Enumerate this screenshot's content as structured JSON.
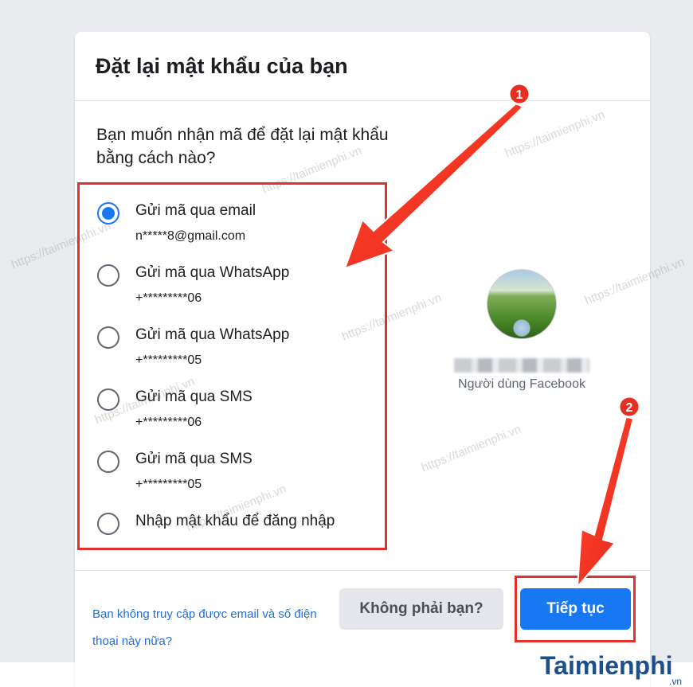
{
  "dialog": {
    "title": "Đặt lại mật khẩu của bạn",
    "question": "Bạn muốn nhận mã để đặt lại mật khẩu bằng cách nào?"
  },
  "options": [
    {
      "label": "Gửi mã qua email",
      "detail": "n*****8@gmail.com",
      "checked": true
    },
    {
      "label": "Gửi mã qua WhatsApp",
      "detail": "+*********06",
      "checked": false
    },
    {
      "label": "Gửi mã qua WhatsApp",
      "detail": "+*********05",
      "checked": false
    },
    {
      "label": "Gửi mã qua SMS",
      "detail": "+*********06",
      "checked": false
    },
    {
      "label": "Gửi mã qua SMS",
      "detail": "+*********05",
      "checked": false
    },
    {
      "label": "Nhập mật khẩu để đăng nhập",
      "detail": "",
      "checked": false
    }
  ],
  "profile": {
    "name": "Người dùng Facebook"
  },
  "footer": {
    "help_link": "Bạn không truy cập được email và số điện thoại này nữa?",
    "not_you_label": "Không phải bạn?",
    "continue_label": "Tiếp tục"
  },
  "annotations": {
    "step1": "1",
    "step2": "2",
    "highlight_color": "#e0322b"
  },
  "watermark": "https://taimienphi.vn",
  "logo": {
    "first": "T",
    "rest": "aimienphi",
    "sub": ".vn"
  },
  "colors": {
    "primary": "#1877f2",
    "link": "#216fdb",
    "background": "#e9ebee"
  }
}
